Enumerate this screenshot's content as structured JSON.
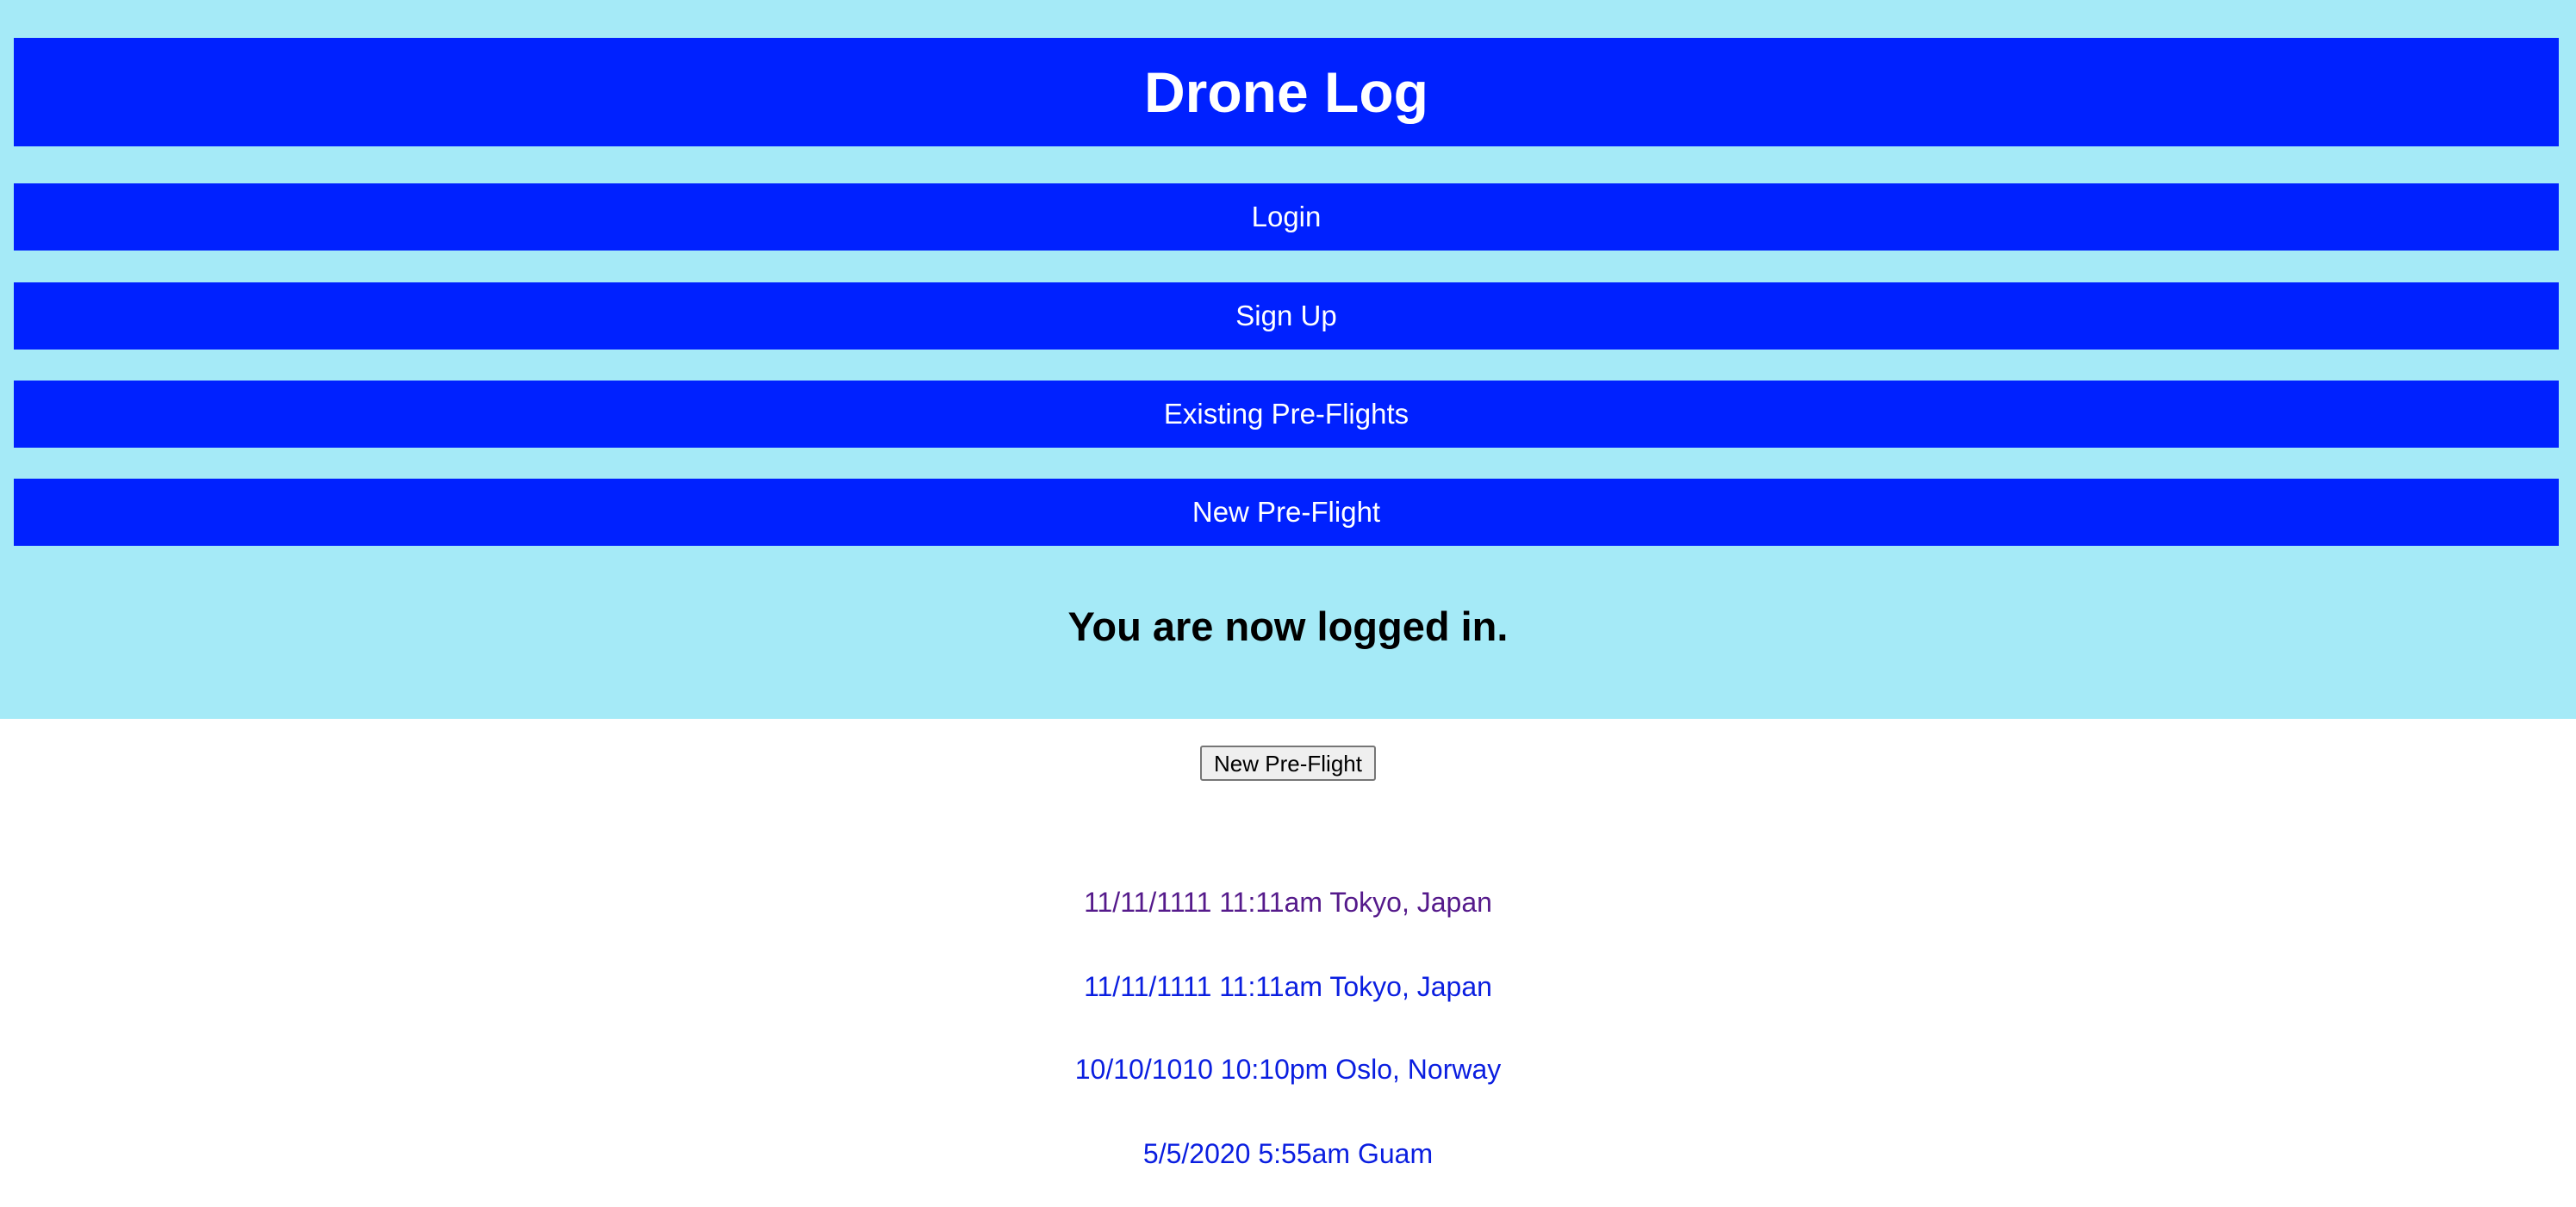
{
  "header": {
    "title": "Drone Log"
  },
  "nav": {
    "items": [
      {
        "label": "Login"
      },
      {
        "label": "Sign Up"
      },
      {
        "label": "Existing Pre-Flights"
      },
      {
        "label": "New Pre-Flight"
      }
    ]
  },
  "status": {
    "message": "You are now logged in."
  },
  "actions": {
    "new_preflight_label": "New Pre-Flight"
  },
  "flights": [
    {
      "label": "11/11/1111 11:11am Tokyo, Japan",
      "visited": true
    },
    {
      "label": "11/11/1111 11:11am Tokyo, Japan",
      "visited": false
    },
    {
      "label": "10/10/1010 10:10pm Oslo, Norway",
      "visited": false
    },
    {
      "label": "5/5/2020 5:55am Guam",
      "visited": false
    }
  ],
  "colors": {
    "page_background": "#ffffff",
    "header_area_background": "#a5eaf7",
    "bar_background": "#0021ff",
    "bar_text": "#ffffff",
    "link": "#0a1ee0",
    "visited_link": "#551a8b"
  }
}
